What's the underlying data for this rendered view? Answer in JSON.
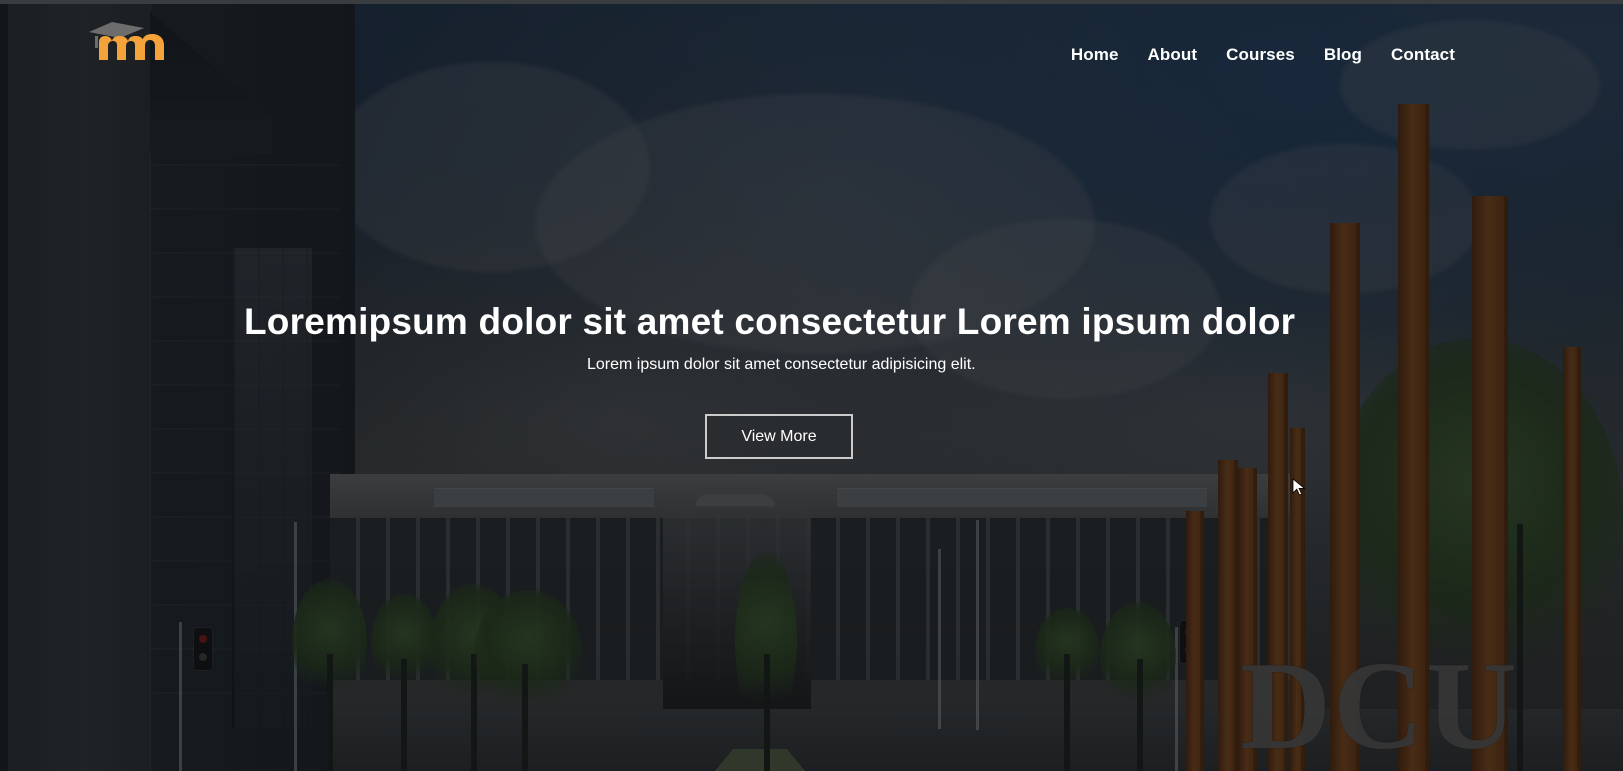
{
  "header": {
    "logo_icon": "mortarboard-m-logo",
    "nav": [
      {
        "label": "Home"
      },
      {
        "label": "About"
      },
      {
        "label": "Courses"
      },
      {
        "label": "Blog"
      },
      {
        "label": "Contact"
      }
    ]
  },
  "hero": {
    "title": "Loremipsum dolor sit amet consectetur Lorem ipsum dolor",
    "subtitle": "Lorem ipsum dolor sit amet consectetur adipisicing elit.",
    "button_label": "View More"
  },
  "background": {
    "sign_text": "DCU"
  },
  "colors": {
    "logo_orange": "#f3a33a",
    "logo_gray": "#6d6d6d",
    "text_white": "#ffffff",
    "button_border": "#e1e1e1"
  },
  "icons": {
    "cursor": "arrow-cursor-icon"
  }
}
